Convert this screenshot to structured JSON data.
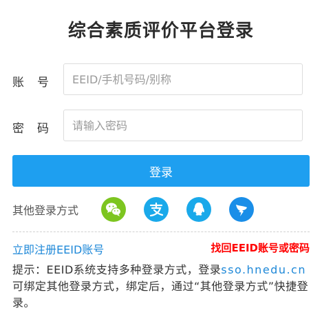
{
  "title": "综合素质评价平台登录",
  "account": {
    "label_char1": "账",
    "label_char2": "号",
    "placeholder": "EEID/手机号码/别称",
    "value": ""
  },
  "password": {
    "label_char1": "密",
    "label_char2": "码",
    "placeholder": "请输入密码",
    "value": ""
  },
  "login_button": "登录",
  "other_login": {
    "label": "其他登录方式",
    "methods": [
      {
        "name": "wechat-icon",
        "color": "#7dc520"
      },
      {
        "name": "alipay-icon",
        "color": "#1aa9ea"
      },
      {
        "name": "qq-icon",
        "color": "#1aa9ea"
      },
      {
        "name": "dingtalk-icon",
        "color": "#1a8ee8"
      }
    ]
  },
  "links": {
    "register": "立即注册EEID账号",
    "recover": "找回EEID账号或密码"
  },
  "tip": {
    "part1": "提示：EEID系统支持多种登录方式，登录",
    "url": "sso.hnedu.cn",
    "part2": "可绑定其他登录方式，绑定后，通过“其他登录方式”快捷登录。"
  }
}
